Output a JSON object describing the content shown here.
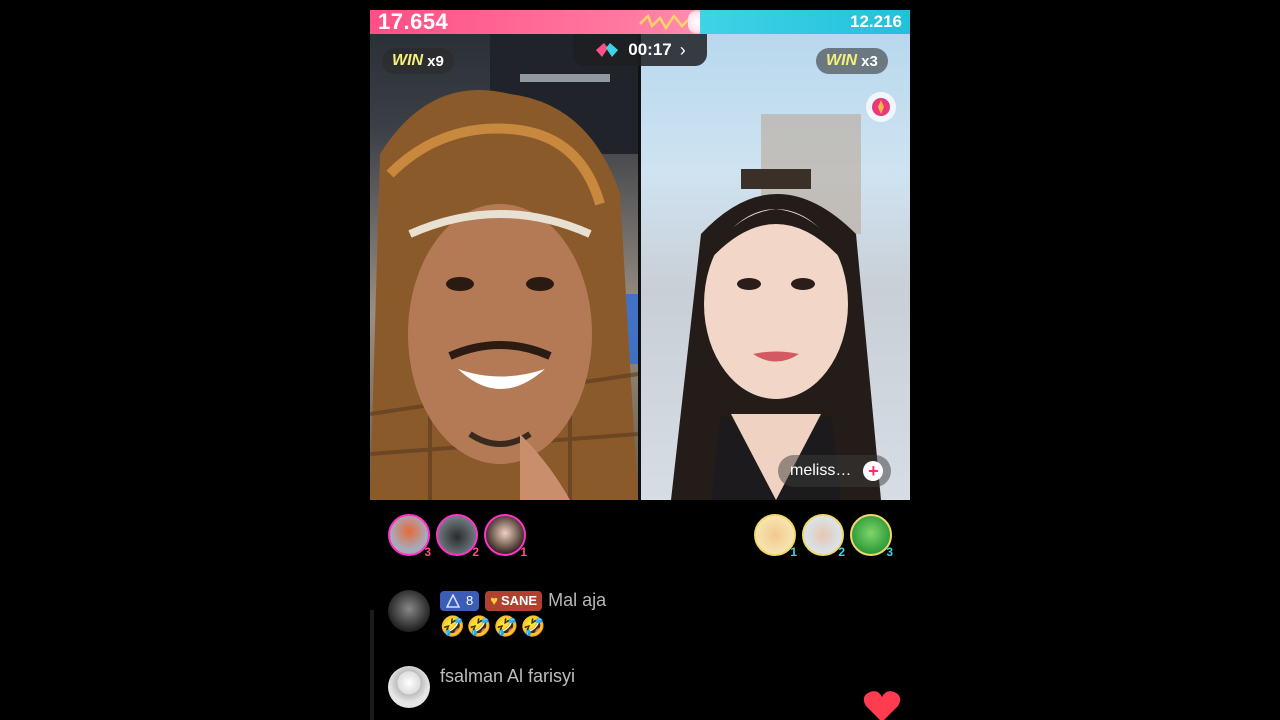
{
  "battle": {
    "left_score": "17.654",
    "right_score": "12.216",
    "timer": "00:17",
    "left_win_word": "WIN",
    "left_win_mult": "x9",
    "right_win_word": "WIN",
    "right_win_mult": "x3"
  },
  "colors": {
    "left_team": "#ff4f86",
    "right_team": "#3fd3e6"
  },
  "right_host": {
    "name": "meliss…",
    "follow_label": "+"
  },
  "left_supporters": [
    {
      "rank": "3"
    },
    {
      "rank": "2"
    },
    {
      "rank": "1"
    }
  ],
  "right_supporters": [
    {
      "rank": "1"
    },
    {
      "rank": "2"
    },
    {
      "rank": "3"
    }
  ],
  "comments": [
    {
      "level": "8",
      "fan_badge": "SANE",
      "message": "Mal aja",
      "emojis": "🤣🤣🤣🤣"
    },
    {
      "username": "fsalman Al farisyi",
      "emojis": "😂😂😂😂😂"
    }
  ],
  "icons": [
    "battle-icon",
    "chevron-right-icon",
    "gift-icon",
    "plus-icon",
    "heart-icon",
    "level-icon",
    "fan-heart-icon"
  ]
}
